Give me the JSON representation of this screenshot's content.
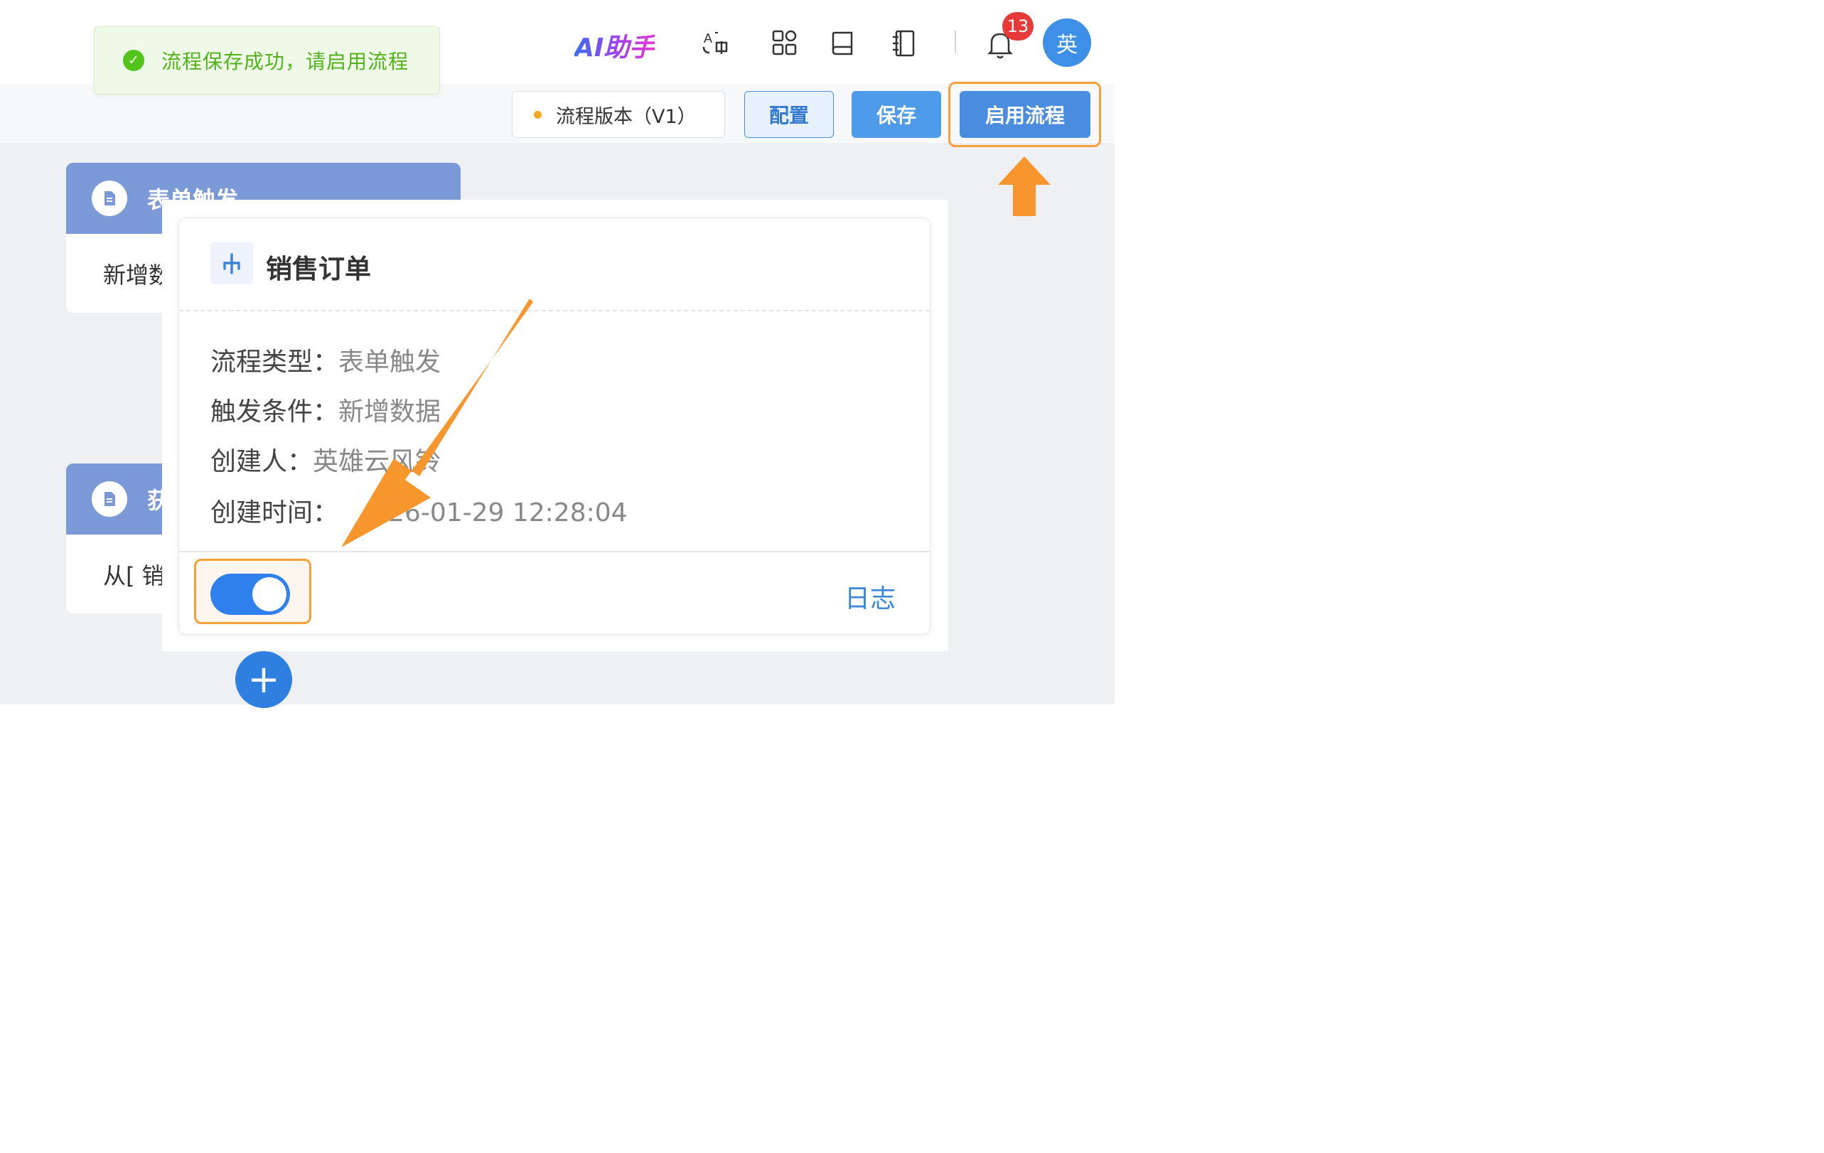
{
  "toast": {
    "message": "流程保存成功，请启用流程",
    "icon": "check-circle-icon"
  },
  "header": {
    "ai_assistant": "AI助手",
    "icons": [
      "translate-icon",
      "apps-grid-icon",
      "book-icon",
      "notebook-icon",
      "bell-icon"
    ],
    "notification_count": "13",
    "avatar_text": "英"
  },
  "toolbar": {
    "version_label": "流程版本（V1）",
    "config_label": "配置",
    "save_label": "保存",
    "enable_label": "启用流程"
  },
  "nodes": [
    {
      "title": "表单触发",
      "body": "新增数"
    },
    {
      "title": "获",
      "body": "从[ 销"
    }
  ],
  "card": {
    "title": "销售订单",
    "fields": [
      {
        "label": "流程类型：",
        "value": "表单触发"
      },
      {
        "label": "触发条件：",
        "value": "新增数据"
      },
      {
        "label": "创建人：",
        "value": "英雄云风铃"
      },
      {
        "label": "创建时间：",
        "value": "26-01-29 12:28:04"
      }
    ],
    "toggle_on": true,
    "log_label": "日志"
  },
  "add_symbol": "+",
  "colors": {
    "primary": "#4a8cdd",
    "highlight": "#f5a03a",
    "success": "#52c41a",
    "node_header": "#7a99d6"
  }
}
